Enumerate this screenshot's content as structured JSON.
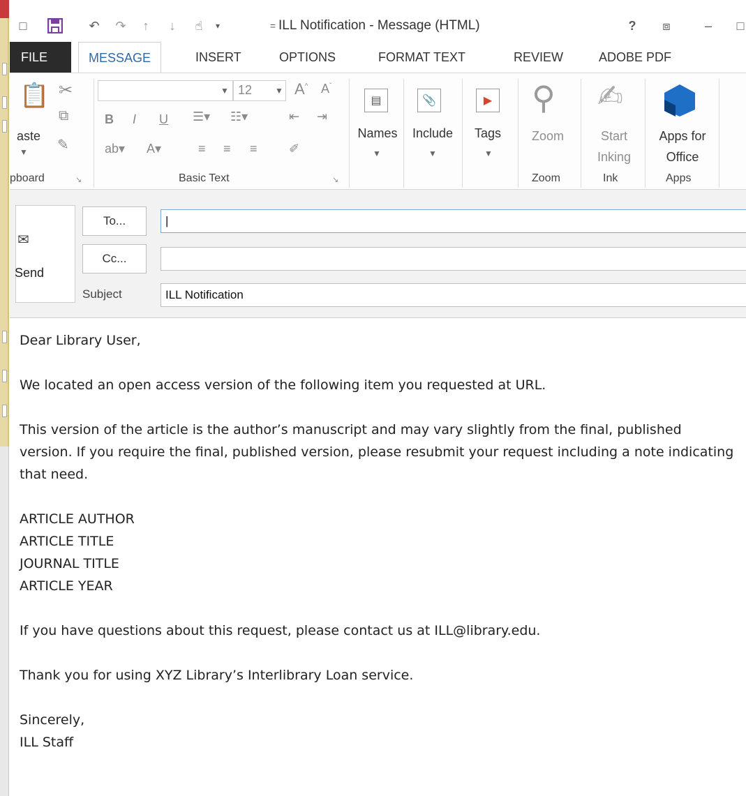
{
  "window": {
    "title": "ILL Notification - Message (HTML)"
  },
  "title_buttons": {
    "help": "?",
    "ribbon_opts": "⧈",
    "minimize": "–"
  },
  "tabs": [
    {
      "label": "FILE"
    },
    {
      "label": "MESSAGE"
    },
    {
      "label": "INSERT"
    },
    {
      "label": "OPTIONS"
    },
    {
      "label": "FORMAT TEXT"
    },
    {
      "label": "REVIEW"
    },
    {
      "label": "ADOBE PDF"
    }
  ],
  "ribbon": {
    "clipboard": {
      "paste_label": "aste",
      "group_label": "pboard"
    },
    "basic_text": {
      "font_size": "12",
      "group_label": "Basic Text"
    },
    "names_label": "Names",
    "include_label": "Include",
    "tags_label": "Tags",
    "zoom": {
      "button_label": "Zoom",
      "group_label": "Zoom"
    },
    "ink": {
      "line1": "Start",
      "line2": "Inking",
      "group_label": "Ink"
    },
    "apps": {
      "line1": "Apps for",
      "line2": "Office",
      "group_label": "Apps"
    }
  },
  "compose": {
    "send_label": "Send",
    "to_label": "To...",
    "cc_label": "Cc...",
    "subject_label": "Subject",
    "to_value": "|",
    "cc_value": "",
    "subject_value": "ILL Notification"
  },
  "body": {
    "greeting": "Dear Library User,",
    "p1": "We located an open access version of the following item you requested at URL.",
    "p2": "This version of the article is the author’s manuscript and may vary slightly from the final, published version. If you require the final, published version, please resubmit your request including a note indicating that need.",
    "citation": [
      "ARTICLE AUTHOR",
      "ARTICLE TITLE",
      "JOURNAL TITLE",
      "ARTICLE YEAR"
    ],
    "p3": "If you have questions about this request, please contact us at ILL@library.edu.",
    "p4": "Thank you for using XYZ Library’s Interlibrary Loan service.",
    "closing": "Sincerely,",
    "signature": "ILL Staff"
  },
  "colors": {
    "accent": "#2e6aa9",
    "file_tab": "#2b2b2b",
    "save_icon": "#7b3fa0",
    "tags_flag": "#d9442a",
    "apps_cube": "#1f6fc7"
  }
}
